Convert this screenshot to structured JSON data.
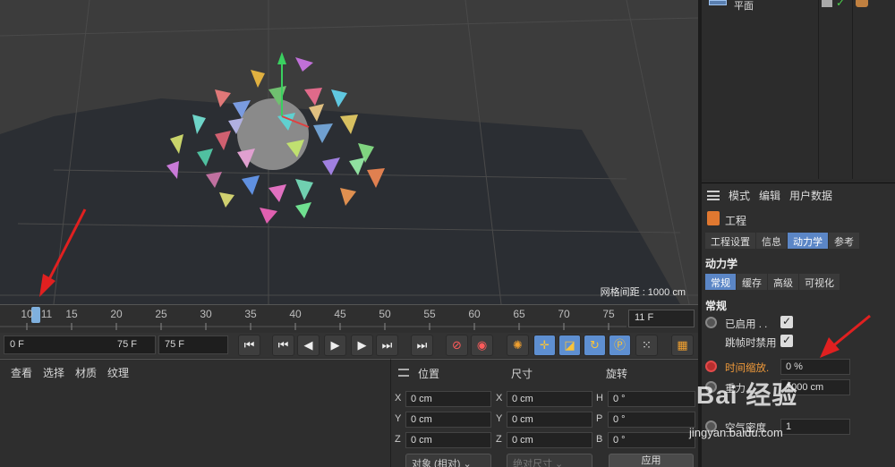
{
  "viewport": {
    "grid_label": "网格间距 : 1000 cm"
  },
  "timeline": {
    "ticks": [
      "10",
      "11",
      "15",
      "20",
      "25",
      "30",
      "35",
      "40",
      "45",
      "50",
      "55",
      "60",
      "65",
      "70",
      "75"
    ],
    "current_frame": "11 F"
  },
  "transport": {
    "start_frame": "0 F",
    "end_frame_small": "75 F",
    "end_frame": "75 F"
  },
  "material_menu": {
    "items": [
      "查看",
      "选择",
      "材质",
      "纹理"
    ]
  },
  "coordinates": {
    "headers": {
      "position": "位置",
      "size": "尺寸",
      "rotation": "旋转"
    },
    "axes": {
      "x": "X",
      "y": "Y",
      "z": "Z",
      "h": "H",
      "p": "P",
      "b": "B"
    },
    "pos": [
      "0 cm",
      "0 cm",
      "0 cm"
    ],
    "size": [
      "0 cm",
      "0 cm",
      "0 cm"
    ],
    "rot": [
      "0 °",
      "0 °",
      "0 °"
    ],
    "mode_select": "对象 (相对)",
    "size_select": "绝对尺寸",
    "apply": "应用"
  },
  "object_manager": {
    "row_label": "平面"
  },
  "attributes": {
    "menu": [
      "模式",
      "编辑",
      "用户数据"
    ],
    "title": "工程",
    "tabs": [
      "工程设置",
      "信息",
      "动力学",
      "参考"
    ],
    "active_tab": "动力学",
    "section": "动力学",
    "subtabs": [
      "常规",
      "缓存",
      "高级",
      "可视化"
    ],
    "active_subtab": "常规",
    "group": "常规",
    "props": {
      "enabled_label": "已启用 . .",
      "skip_label": "跳帧时禁用",
      "time_scale_label": "时间缩放.",
      "time_scale_value": "0 %",
      "gravity_label": "重力",
      "gravity_value": "1000 cm",
      "air_label": "空气密度",
      "air_value": "1"
    }
  },
  "watermark": {
    "brand": "Bai  经验",
    "url": "jingyan.baidu.com"
  },
  "colors": {
    "accent": "#5b86c6",
    "highlight": "#f09a3a",
    "arrow": "#e02020"
  }
}
